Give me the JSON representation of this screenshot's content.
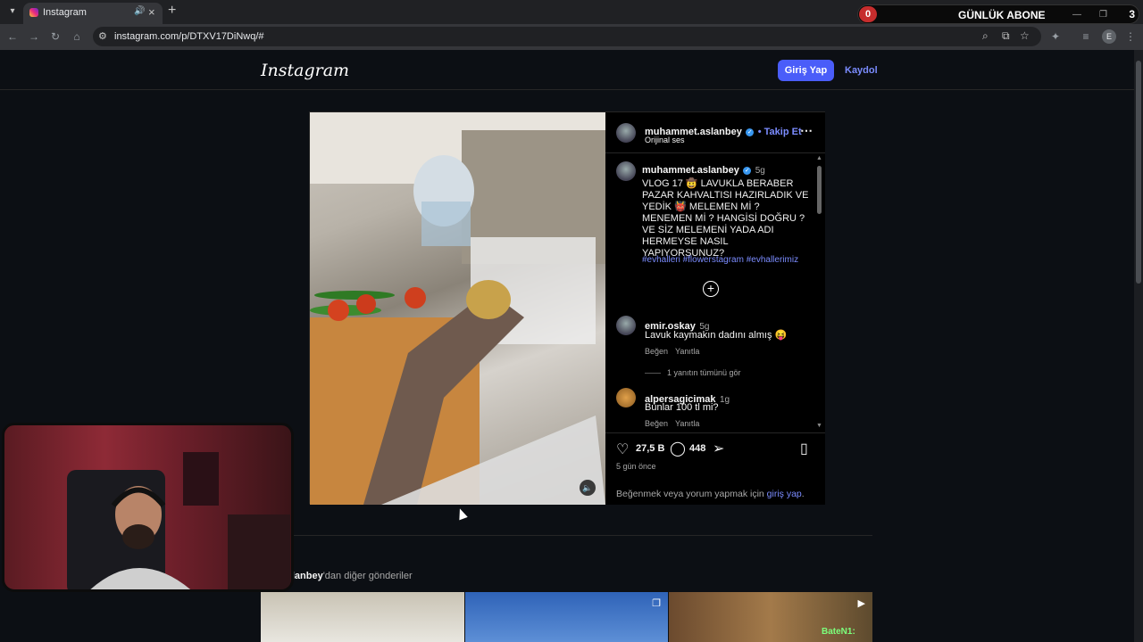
{
  "browser": {
    "tab_title": "Instagram",
    "url": "instagram.com/p/DTXV17DiNwq/#",
    "profile_initial": "E"
  },
  "overlay_widget": {
    "left_count": "0",
    "title": "GÜNLÜK ABONE",
    "right_count": "3"
  },
  "ig": {
    "logo": "Instagram",
    "login_label": "Giriş Yap",
    "signup_label": "Kaydol"
  },
  "post": {
    "author": "muhammet.aslanbey",
    "follow_label": "• Takip Et",
    "audio": "Orijinal ses",
    "caption_age": "5g",
    "caption": "VLOG 17 🤠 LAVUKLA BERABER PAZAR KAHVALTISI HAZIRLADIK VE YEDİK 👹 MELEMEN Mİ ? MENEMEN Mİ ? HANGİSİ DOĞRU ? VE SİZ MELEMENİ YADA ADI HERMEYSE NASIL YAPIYORSUNUZ?",
    "hashtags": "#evhalleri #flowerstagram #evhallerimiz",
    "likes": "27,5 B",
    "comments_count": "448",
    "posted": "5 gün önce",
    "login_prompt_prefix": "Beğenmek veya yorum yapmak için",
    "login_prompt_link": "giriş yap",
    "login_prompt_suffix": "."
  },
  "comments": [
    {
      "user": "emir.oskay",
      "age": "5g",
      "text": "Lavuk kaymakın dadını almış 😝",
      "like_label": "Beğen",
      "reply_label": "Yanıtla",
      "replies_label": "1 yanıtın tümünü gör"
    },
    {
      "user": "alpersagicimak",
      "age": "1g",
      "text": "Bunlar 100 tl mi?",
      "like_label": "Beğen",
      "reply_label": "Yanıtla"
    }
  ],
  "more_posts": {
    "user_fragment": "met.aslanbey",
    "suffix": "'dan diğer gönderiler"
  },
  "chat": {
    "name": "BateN1:"
  },
  "icons": [
    "search-icon",
    "back-icon",
    "forward-icon",
    "reload-icon",
    "home-icon",
    "star-icon",
    "extensions-icon",
    "more-icon",
    "heart-icon",
    "comment-icon",
    "share-icon",
    "bookmark-icon",
    "add-icon",
    "mute-icon"
  ]
}
